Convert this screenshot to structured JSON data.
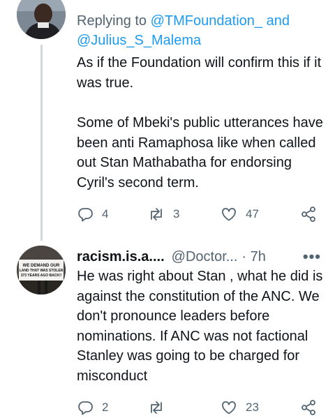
{
  "tweet1": {
    "replying_prefix": "Replying to ",
    "mention1": "@TMFoundation_",
    "and_text": " and",
    "mention2": "@Julius_S_Malema",
    "para1": "As if the Foundation will confirm this if it was true.",
    "para2": "Some of Mbeki's public utterances have been anti Ramaphosa like when called out Stan Mathabatha for endorsing Cyril's second term.",
    "replies": "4",
    "retweets": "3",
    "likes": "47"
  },
  "tweet2": {
    "display_name": "racism.is.a....",
    "handle": "@Doctor...",
    "time": "· 7h",
    "more": "•••",
    "avatar_sign_text": "WE DEMAND OUR LAND THAT WAS STOLEN 373 YEARS AGO BACK!!",
    "text": "He was right about Stan , what he did is against the constitution of the ANC. We don't pronounce leaders before nominations. If ANC was not factional Stanley was going to be charged for misconduct",
    "replies": "2",
    "likes": "23"
  },
  "icons": [
    "reply-icon",
    "retweet-icon",
    "like-icon",
    "share-icon"
  ],
  "colors": {
    "link": "#1d9bf0",
    "secondary": "#536471",
    "thread_line": "#cfd9de"
  }
}
